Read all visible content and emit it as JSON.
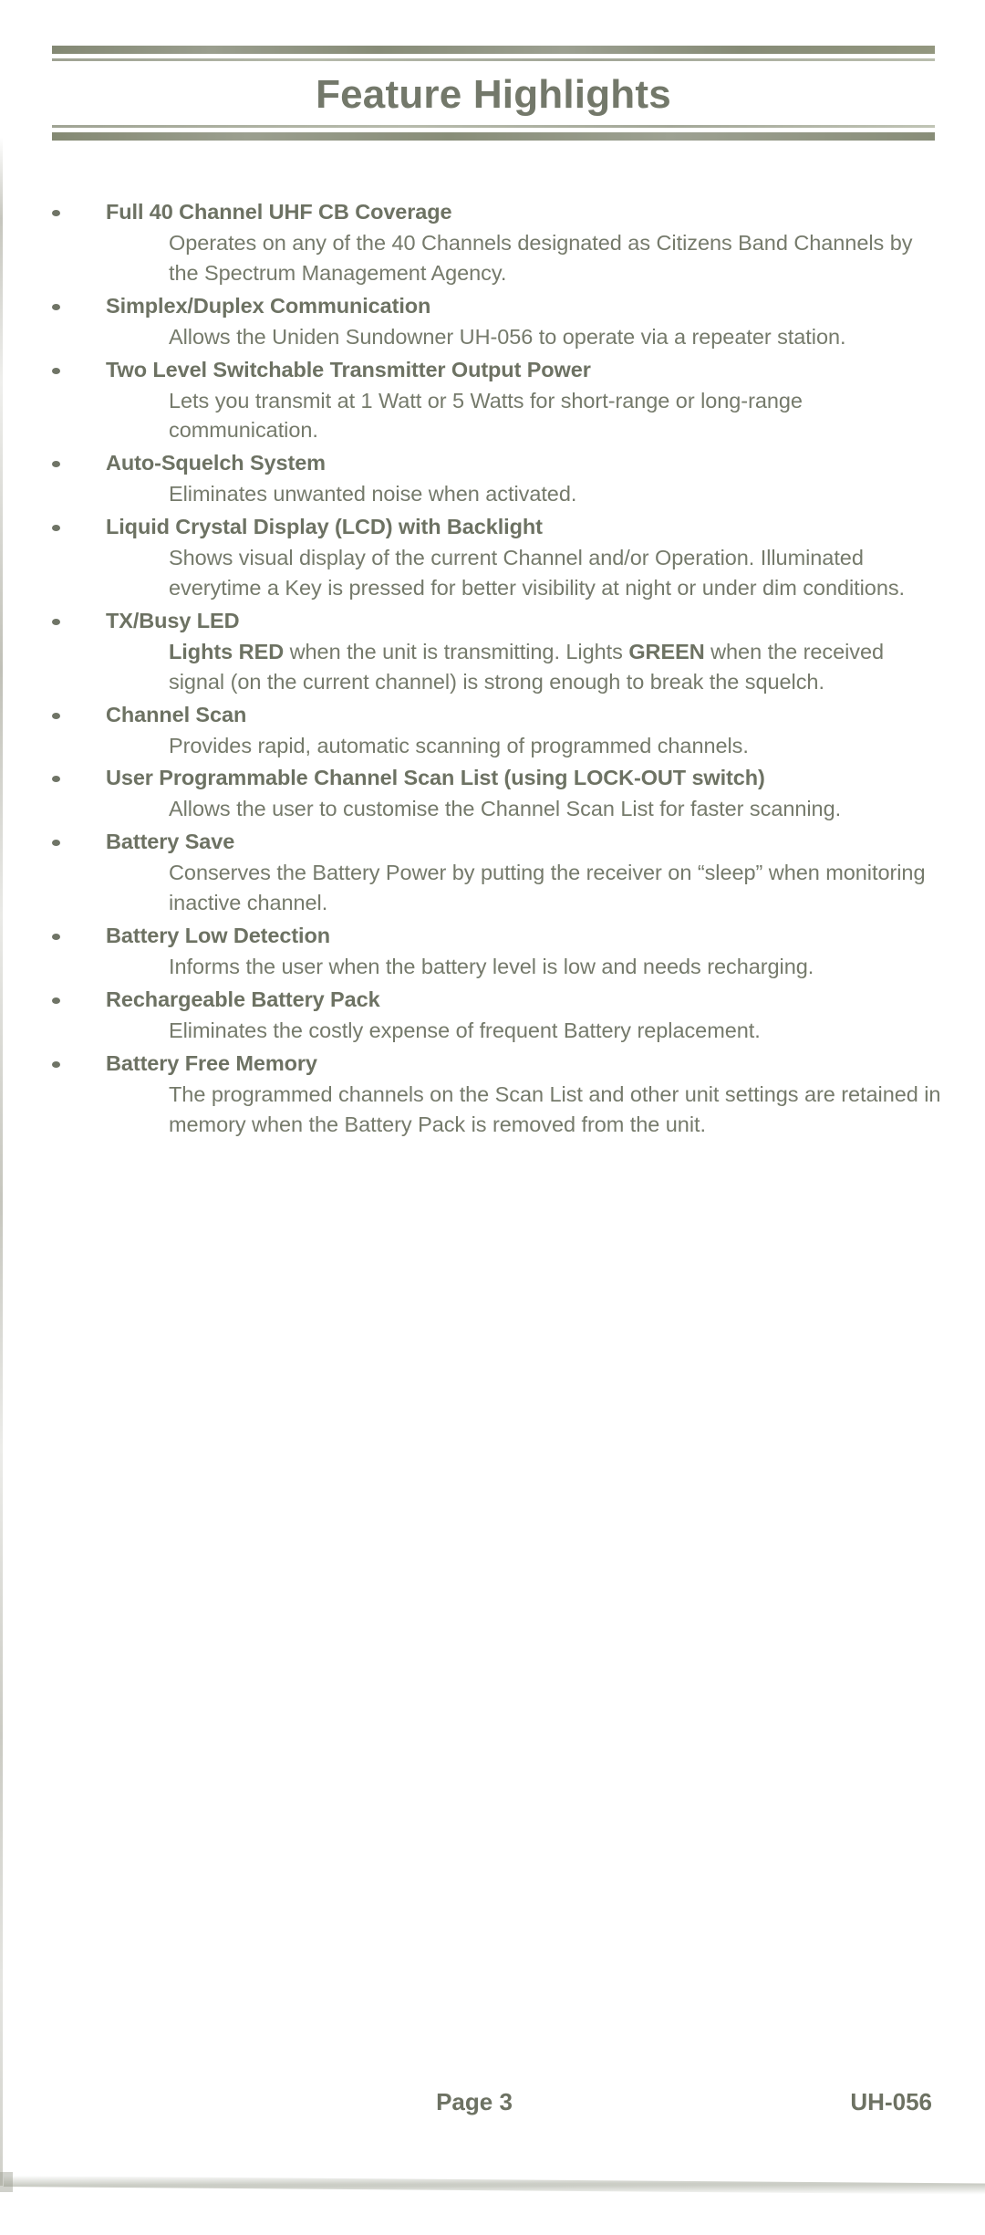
{
  "document": {
    "title": "Feature Highlights",
    "features": [
      {
        "title": "Full 40 Channel UHF CB Coverage",
        "body": "Operates on any of the 40 Channels designated as Citizens Band Channels by the Spectrum Management Agency."
      },
      {
        "title": "Simplex/Duplex Communication",
        "body": "Allows the Uniden Sundowner UH-056 to operate via a repeater station."
      },
      {
        "title": "Two Level Switchable Transmitter Output Power",
        "body": "Lets you transmit at 1 Watt or 5 Watts for short-range or long-range communication."
      },
      {
        "title": "Auto-Squelch System",
        "body": "Eliminates unwanted noise when activated."
      },
      {
        "title": "Liquid Crystal Display (LCD) with Backlight",
        "body": "Shows visual display of the current Channel and/or Operation.  Illuminated everytime a Key is pressed for better visibility at night or under dim conditions."
      },
      {
        "title": "TX/Busy LED",
        "body_html": "<b>Lights RED</b> when the unit is transmitting.  Lights <b>GREEN</b> when the received signal (on the current channel) is strong enough to break the squelch."
      },
      {
        "title": "Channel Scan",
        "body": "Provides rapid, automatic scanning of programmed channels."
      },
      {
        "title": "User Programmable Channel Scan List (using LOCK-OUT switch)",
        "body": "Allows the user to customise the Channel Scan List for faster scanning."
      },
      {
        "title": "Battery Save",
        "body": "Conserves the Battery Power by putting the receiver on “sleep” when monitoring inactive channel."
      },
      {
        "title": "Battery Low Detection",
        "body": "Informs the user when the battery level is low and needs recharging."
      },
      {
        "title": "Rechargeable Battery Pack",
        "body": "Eliminates the costly expense of frequent Battery replacement."
      },
      {
        "title": "Battery Free Memory",
        "body": "The programmed channels on the Scan List and other unit settings are retained in memory when the Battery Pack is removed from the unit."
      }
    ],
    "footer": {
      "page_label": "Page 3",
      "model_label": "UH-056"
    },
    "colors": {
      "text": "#74796a",
      "heading": "#6d7263",
      "rule_thick": "#8d9182",
      "rule_thin": "#a7ab9c",
      "background": "#ffffff"
    }
  }
}
